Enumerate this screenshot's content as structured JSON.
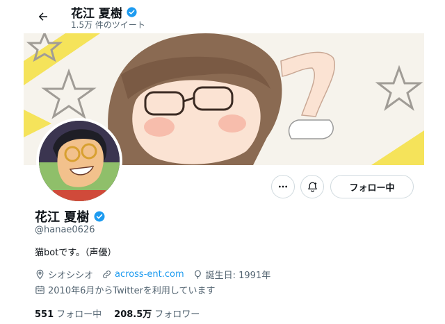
{
  "header": {
    "name": "花江 夏樹",
    "tweet_count": "1.5万 件のツイート"
  },
  "profile": {
    "name": "花江 夏樹",
    "handle": "@hanae0626",
    "bio": "猫botです。（声優）",
    "location": "シオシシオ",
    "website": "across-ent.com",
    "birthday": "誕生日: 1991年",
    "joined": "2010年6月からTwitterを利用しています",
    "following_count": "551",
    "following_label": "フォロー中",
    "followers_count": "208.5万",
    "followers_label": "フォロワー"
  },
  "actions": {
    "follow_label": "フォロー中"
  },
  "colors": {
    "accent": "#1d9bf0",
    "text": "#0f1419",
    "muted": "#536471",
    "border": "#cfd9de"
  },
  "icons": [
    "back-arrow-icon",
    "verified-badge-icon",
    "more-icon",
    "notification-bell-icon",
    "location-icon",
    "link-icon",
    "birthday-icon",
    "calendar-icon"
  ]
}
